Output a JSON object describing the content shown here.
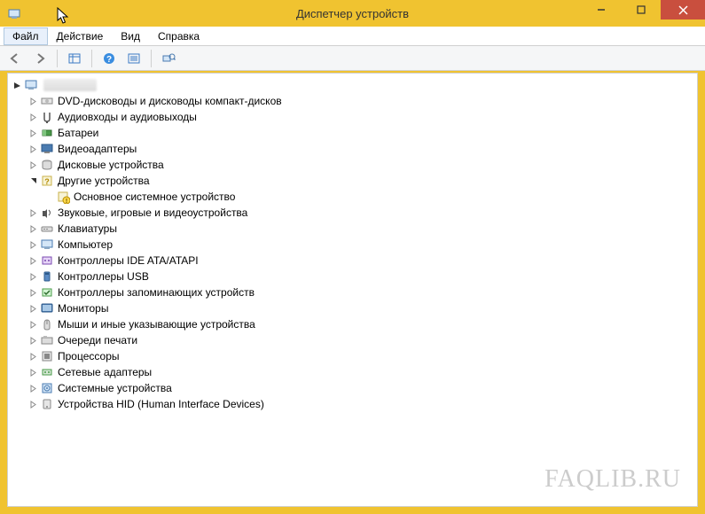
{
  "window": {
    "title": "Диспетчер устройств"
  },
  "menu": {
    "file": "Файл",
    "action": "Действие",
    "view": "Вид",
    "help": "Справка"
  },
  "watermark": "FAQLIB.RU",
  "tree": {
    "root": "",
    "nodes": [
      {
        "label": "DVD-дисководы и дисководы компакт-дисков"
      },
      {
        "label": "Аудиовходы и аудиовыходы"
      },
      {
        "label": "Батареи"
      },
      {
        "label": "Видеоадаптеры"
      },
      {
        "label": "Дисковые устройства"
      },
      {
        "label": "Другие устройства",
        "open": true,
        "children": [
          {
            "label": "Основное системное устройство",
            "warn": true
          }
        ]
      },
      {
        "label": "Звуковые, игровые и видеоустройства"
      },
      {
        "label": "Клавиатуры"
      },
      {
        "label": "Компьютер"
      },
      {
        "label": "Контроллеры IDE ATA/ATAPI"
      },
      {
        "label": "Контроллеры USB"
      },
      {
        "label": "Контроллеры запоминающих устройств"
      },
      {
        "label": "Мониторы"
      },
      {
        "label": "Мыши и иные указывающие устройства"
      },
      {
        "label": "Очереди печати"
      },
      {
        "label": "Процессоры"
      },
      {
        "label": "Сетевые адаптеры"
      },
      {
        "label": "Системные устройства"
      },
      {
        "label": "Устройства HID (Human Interface Devices)"
      }
    ]
  }
}
